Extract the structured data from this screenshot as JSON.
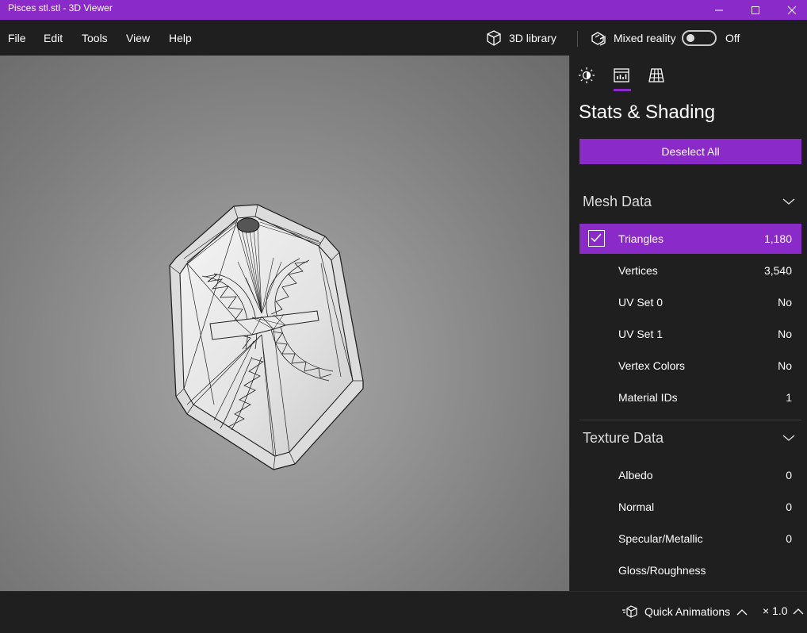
{
  "window": {
    "title": "Pisces stl.stl - 3D Viewer",
    "accent_color": "#8a2ac8"
  },
  "menu": {
    "items": [
      "File",
      "Edit",
      "Tools",
      "View",
      "Help"
    ],
    "library_label": "3D library",
    "mixed_reality_label": "Mixed reality",
    "toggle_state": "Off"
  },
  "panel": {
    "tabs": [
      "lighting-icon",
      "stats-icon",
      "grid-icon"
    ],
    "active_tab": 1,
    "title": "Stats & Shading",
    "deselect_label": "Deselect All",
    "mesh_section": {
      "title": "Mesh Data",
      "rows": [
        {
          "name": "Triangles",
          "value": "1,180",
          "checked": true
        },
        {
          "name": "Vertices",
          "value": "3,540"
        },
        {
          "name": "UV Set 0",
          "value": "No"
        },
        {
          "name": "UV Set 1",
          "value": "No"
        },
        {
          "name": "Vertex Colors",
          "value": "No"
        },
        {
          "name": "Material IDs",
          "value": "1"
        }
      ]
    },
    "texture_section": {
      "title": "Texture Data",
      "rows": [
        {
          "name": "Albedo",
          "value": "0"
        },
        {
          "name": "Normal",
          "value": "0"
        },
        {
          "name": "Specular/Metallic",
          "value": "0"
        },
        {
          "name": "Gloss/Roughness",
          "value": ""
        }
      ]
    }
  },
  "statusbar": {
    "quick_animations_label": "Quick Animations",
    "speed_label": "× 1.0"
  }
}
